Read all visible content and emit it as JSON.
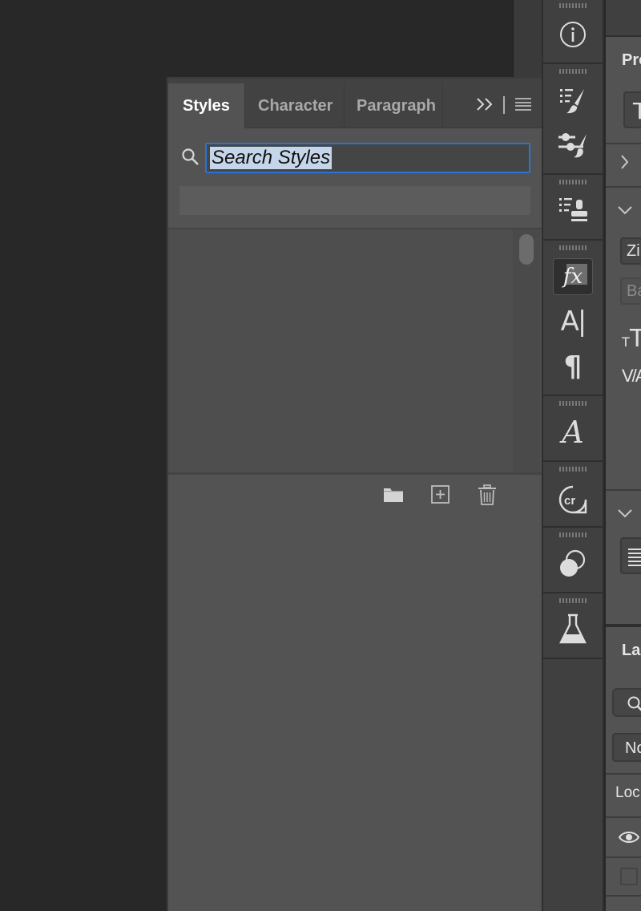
{
  "styles_panel": {
    "tabs": [
      {
        "label": "Styles",
        "active": true
      },
      {
        "label": "Character",
        "active": false
      },
      {
        "label": "Paragraph",
        "active": false
      }
    ],
    "search": {
      "placeholder": "Search Styles",
      "value": "Search Styles",
      "selected": true
    },
    "footer_icons": [
      "new-group-folder-icon",
      "new-style-icon",
      "delete-icon"
    ]
  },
  "toolbar": {
    "icons": [
      "info-icon",
      "brushes-icon",
      "brush-settings-icon",
      "clone-source-icon",
      "styles-fx-icon",
      "character-icon",
      "paragraph-icon",
      "glyphs-icon",
      "libraries-icon",
      "adjustments-icon",
      "labs-icon"
    ],
    "character_glyph": "A|",
    "paragraph_glyph": "¶",
    "glyphs_glyph": "A",
    "fx_glyph": "fx",
    "cr_glyph": "cr"
  },
  "right_panel": {
    "properties_title": "Pro",
    "font_field": "Zi",
    "style_field": "Ba",
    "kerning_label": "V/A",
    "layers_title": "La",
    "blend_mode": "No",
    "lock_label": "Loc"
  },
  "colors": {
    "panel_bg": "#535353",
    "tabbar_bg": "#424242",
    "toolbar_bg": "#404040",
    "app_bg": "#282828",
    "focus_accent": "#2b73d6"
  }
}
